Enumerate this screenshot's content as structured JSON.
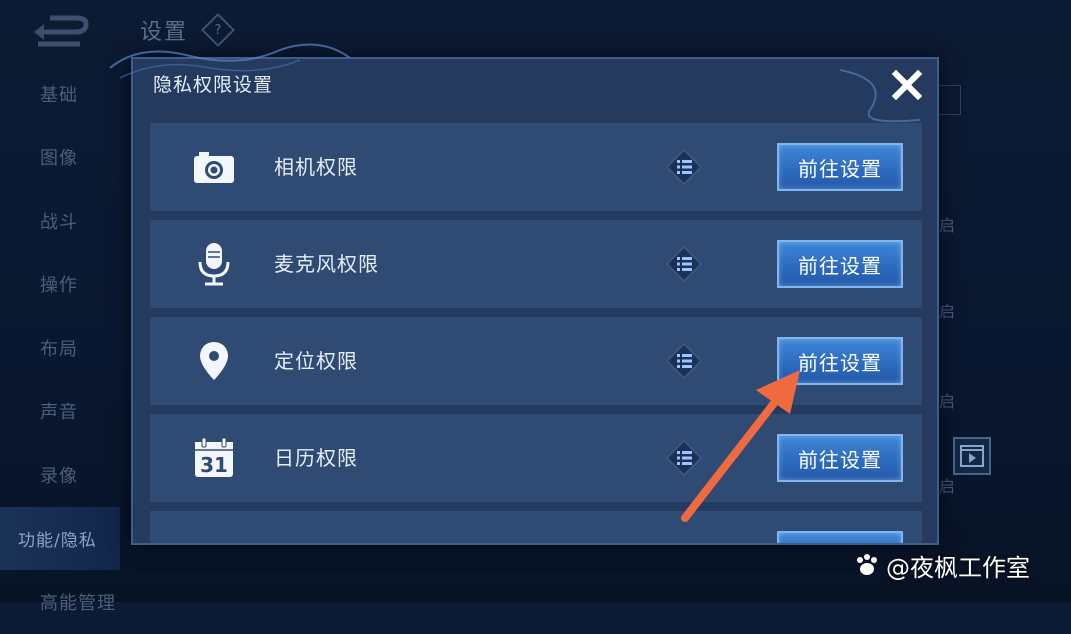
{
  "background": {
    "title": "设置",
    "help_glyph": "?",
    "nav_items": [
      "基础",
      "图像",
      "战斗",
      "操作",
      "布局",
      "声音",
      "录像",
      "功能/隐私",
      "高能管理"
    ],
    "side_fragment": "启"
  },
  "modal": {
    "title": "隐私权限设置",
    "rows": [
      {
        "icon": "camera-icon",
        "label": "相机权限",
        "button": "前往设置"
      },
      {
        "icon": "microphone-icon",
        "label": "麦克风权限",
        "button": "前往设置"
      },
      {
        "icon": "location-pin-icon",
        "label": "定位权限",
        "button": "前往设置"
      },
      {
        "icon": "calendar-icon",
        "label": "日历权限",
        "button": "前往设置"
      },
      {
        "icon": "",
        "label": "",
        "button": ""
      }
    ]
  },
  "calendar_day": "31",
  "watermark": "@夜枫工作室",
  "colors": {
    "modal_bg": "#243b5f",
    "row_bg": "#2f4b73",
    "button_bg": "#2e6bbf",
    "arrow": "#f06a40"
  }
}
